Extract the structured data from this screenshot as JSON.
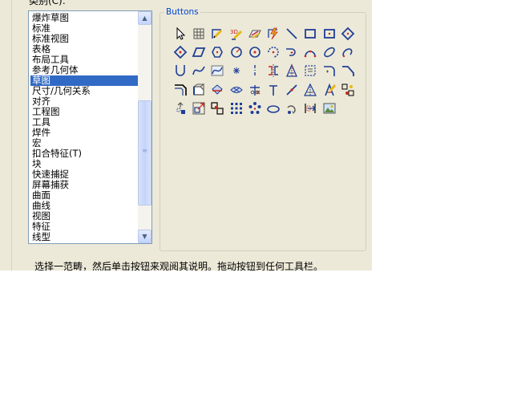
{
  "category": {
    "label": "类别(C):",
    "items": [
      "爆炸草图",
      "标准",
      "标准视图",
      "表格",
      "布局工具",
      "参考几何体",
      "草图",
      "尺寸/几何关系",
      "对齐",
      "工程图",
      "工具",
      "焊件",
      "宏",
      "扣合特征(T)",
      "块",
      "快速捕捉",
      "屏幕捕获",
      "曲面",
      "曲线",
      "视图",
      "特征",
      "线型"
    ],
    "selected_index": 6
  },
  "buttons_group": {
    "title": "Buttons",
    "icons": [
      "select-arrow-icon",
      "grid-icon",
      "sketch-icon",
      "3d-sketch-icon",
      "sketch-plane-icon",
      "rapid-sketch-icon",
      "line-icon",
      "rectangle-icon",
      "center-rectangle-icon",
      "corner-rectangle-icon",
      "three-point-rectangle-icon",
      "parallelogram-icon",
      "polygon-icon",
      "circle-icon",
      "perimeter-circle-icon",
      "centerpoint-arc-icon",
      "tangent-arc-icon",
      "three-point-arc-icon",
      "ellipse-icon",
      "partial-ellipse-icon",
      "parabola-icon",
      "spline-icon",
      "spline-on-surface-icon",
      "point-icon",
      "centerline-icon",
      "mirror-entities-icon",
      "dynamic-mirror-icon",
      "sketch-picture-icon",
      "fillet-icon",
      "chamfer-icon",
      "offset-entities-icon",
      "convert-entities-icon",
      "intersection-curve-icon",
      "face-curves-icon",
      "trim-icon",
      "extend-icon",
      "split-entities-icon",
      "construction-geometry-icon",
      "sketch-text-icon",
      "block-icon",
      "move-entities-icon",
      "scale-entities-icon",
      "copy-entities-icon",
      "linear-pattern-icon",
      "circular-pattern-icon",
      "slot-icon",
      "rotate-entities-icon",
      "stretch-entities-icon",
      "image-icon"
    ]
  },
  "description": "选择一范畴，然后单击按钮来观阅其说明。拖动按钮到任何工具栏。"
}
